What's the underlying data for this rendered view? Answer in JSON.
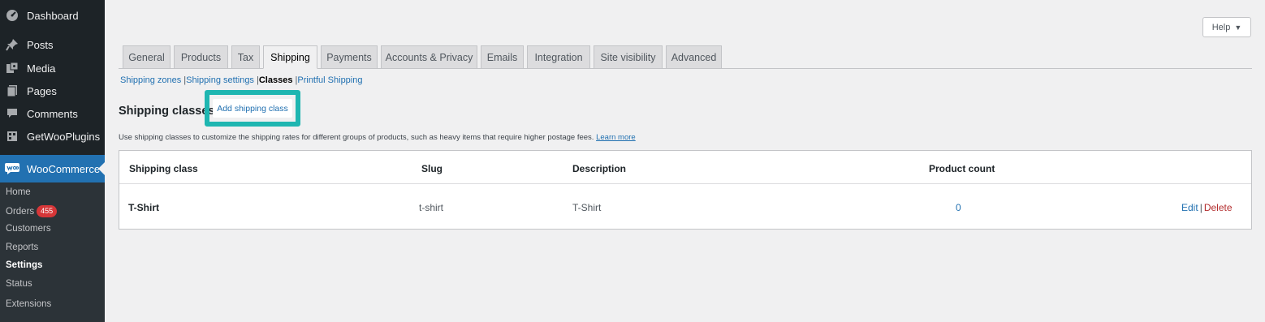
{
  "sidebar": {
    "items": [
      {
        "label": "Dashboard",
        "icon": "dashboard-icon"
      },
      {
        "label": "Posts",
        "icon": "pin-icon"
      },
      {
        "label": "Media",
        "icon": "media-icon"
      },
      {
        "label": "Pages",
        "icon": "pages-icon"
      },
      {
        "label": "Comments",
        "icon": "comments-icon"
      },
      {
        "label": "GetWooPlugins",
        "icon": "plugin-icon"
      },
      {
        "label": "WooCommerce",
        "icon": "woocommerce-icon"
      }
    ],
    "submenu": {
      "home": "Home",
      "orders": "Orders",
      "orders_badge": "455",
      "customers": "Customers",
      "reports": "Reports",
      "settings": "Settings",
      "status": "Status",
      "extensions": "Extensions"
    }
  },
  "help": {
    "label": "Help",
    "arrow": "▼"
  },
  "tabs": [
    "General",
    "Products",
    "Tax",
    "Shipping",
    "Payments",
    "Accounts & Privacy",
    "Emails",
    "Integration",
    "Site visibility",
    "Advanced"
  ],
  "active_tab": "Shipping",
  "subnav": {
    "zones": "Shipping zones",
    "settings": "Shipping settings",
    "classes": "Classes",
    "printful": "Printful Shipping",
    "sep": "|"
  },
  "page": {
    "title": "Shipping classes",
    "add_button": "Add shipping class",
    "description": "Use shipping classes to customize the shipping rates for different groups of products, such as heavy items that require higher postage fees.",
    "learn_more": "Learn more"
  },
  "table": {
    "headers": {
      "class": "Shipping class",
      "slug": "Slug",
      "description": "Description",
      "count": "Product count"
    },
    "rows": [
      {
        "name": "T-Shirt",
        "slug": "t-shirt",
        "description": "T-Shirt",
        "count": "0",
        "edit": "Edit",
        "sep": "|",
        "delete": "Delete"
      }
    ]
  },
  "colors": {
    "sidebar_bg": "#1d2327",
    "active_menu": "#2271b1",
    "highlight": "#1fb6b1",
    "link": "#2271b1",
    "delete": "#b32d2e",
    "badge": "#d63638"
  }
}
